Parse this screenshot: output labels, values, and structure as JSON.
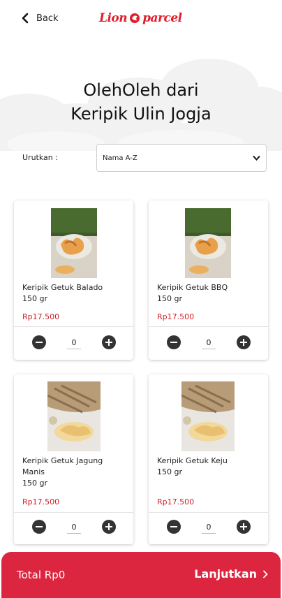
{
  "header": {
    "back_label": "Back",
    "logo_text": "Lion parcel"
  },
  "title": {
    "line1": "OlehOleh dari",
    "line2": "Keripik Ulin Jogja"
  },
  "sort": {
    "label": "Urutkan :",
    "selected": "Nama A-Z"
  },
  "products": [
    {
      "name": "Keripik Getuk Balado",
      "weight": "150 gr",
      "price": "Rp17.500",
      "qty": "0"
    },
    {
      "name": "Keripik Getuk BBQ",
      "weight": "150 gr",
      "price": "Rp17.500",
      "qty": "0"
    },
    {
      "name": "Keripik Getuk Jagung Manis",
      "weight": "150 gr",
      "price": "Rp17.500",
      "qty": "0"
    },
    {
      "name": "Keripik Getuk Keju",
      "weight": "150 gr",
      "price": "Rp17.500",
      "qty": "0"
    }
  ],
  "footer": {
    "total": "Total Rp0",
    "next_label": "Lanjutkan"
  },
  "colors": {
    "brand": "#e21d2b",
    "footer": "#dc2640",
    "price": "#d0202a"
  }
}
